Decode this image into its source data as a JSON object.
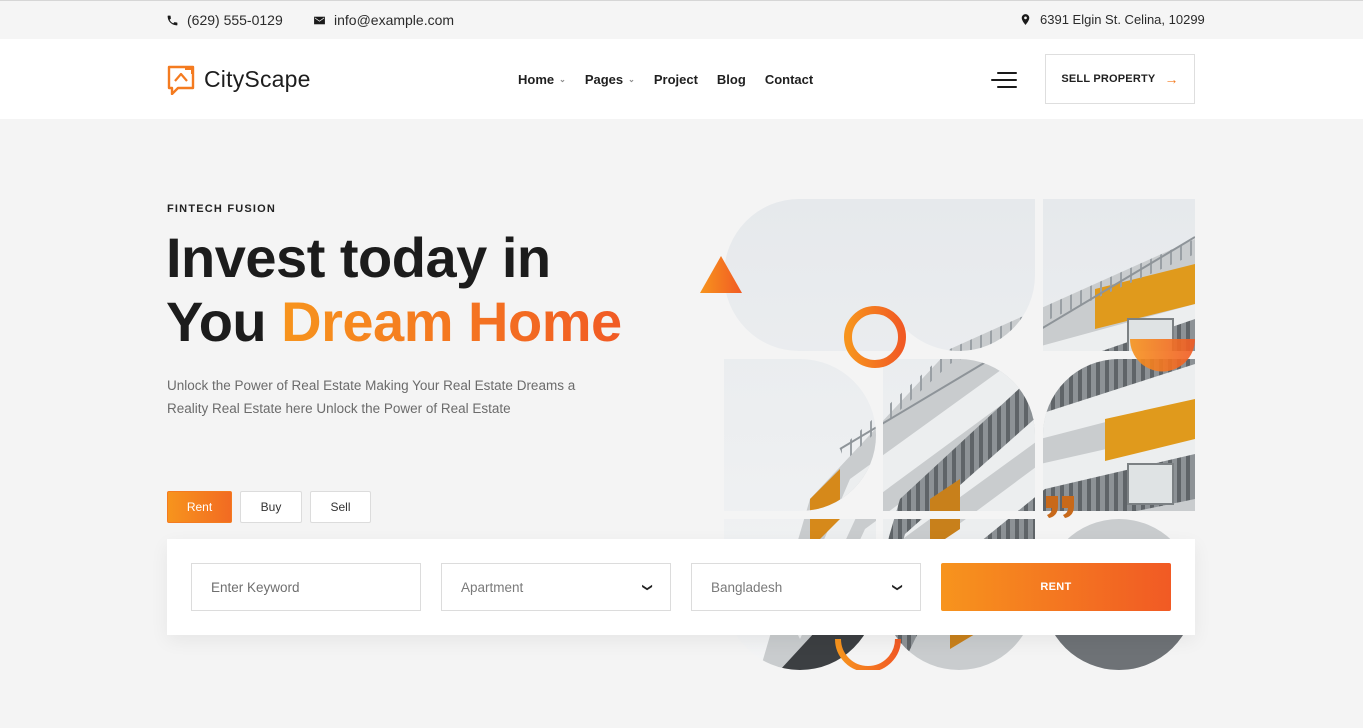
{
  "topbar": {
    "phone": "(629) 555-0129",
    "email": "info@example.com",
    "address": "6391 Elgin St. Celina, 10299"
  },
  "header": {
    "logo_text": "CityScape",
    "nav": [
      {
        "label": "Home",
        "has_dropdown": true
      },
      {
        "label": "Pages",
        "has_dropdown": true
      },
      {
        "label": "Project",
        "has_dropdown": false
      },
      {
        "label": "Blog",
        "has_dropdown": false
      },
      {
        "label": "Contact",
        "has_dropdown": false
      }
    ],
    "cta_label": "SELL PROPERTY"
  },
  "hero": {
    "eyebrow": "FINTECH FUSION",
    "headline_line1": "Invest today in",
    "headline_line2_plain": "You",
    "headline_line2_accent": "Dream Home",
    "description": "Unlock the Power of Real Estate Making Your Real Estate Dreams a Reality Real Estate here Unlock the Power of Real Estate"
  },
  "tabs": [
    {
      "label": "Rent",
      "active": true
    },
    {
      "label": "Buy",
      "active": false
    },
    {
      "label": "Sell",
      "active": false
    }
  ],
  "search": {
    "keyword_placeholder": "Enter Keyword",
    "type_value": "Apartment",
    "location_value": "Bangladesh",
    "submit_label": "RENT"
  },
  "colors": {
    "accent_start": "#f7941d",
    "accent_end": "#f15a24",
    "text_dark": "#1c1c1c"
  },
  "icons": [
    "phone-icon",
    "envelope-icon",
    "map-pin-icon",
    "house-logo-icon",
    "hamburger-icon",
    "arrow-right-icon",
    "chevron-down-icon",
    "quote-icon"
  ]
}
